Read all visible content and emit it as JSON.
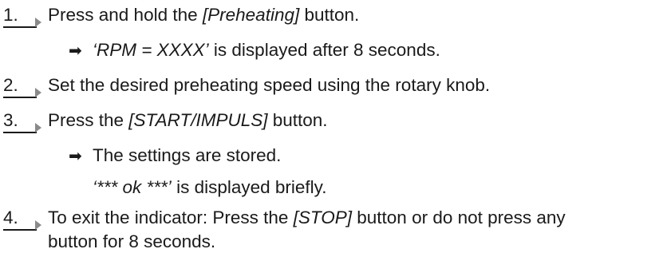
{
  "steps": [
    {
      "number": "1.",
      "pre": "Press and hold the ",
      "emph": "[Preheating]",
      "post": " button.",
      "result": {
        "emph": "‘RPM = XXXX’",
        "post": " is displayed after 8 seconds."
      }
    },
    {
      "number": "2.",
      "text": "Set the desired preheating speed using the rotary knob."
    },
    {
      "number": "3.",
      "pre": "Press the ",
      "emph": "[START/IMPULS]",
      "post": " button.",
      "result": {
        "text": "The settings are stored."
      },
      "note": {
        "emph": "‘*** ok ***’",
        "post": " is displayed briefly."
      }
    },
    {
      "number": "4.",
      "pre": "To exit the indicator: Press the ",
      "emph": "[STOP]",
      "post": " button or do not press any",
      "line2": "button for 8 seconds."
    }
  ],
  "icons": {
    "step_marker": "step-arrow-marker",
    "result_arrow": "➡"
  }
}
